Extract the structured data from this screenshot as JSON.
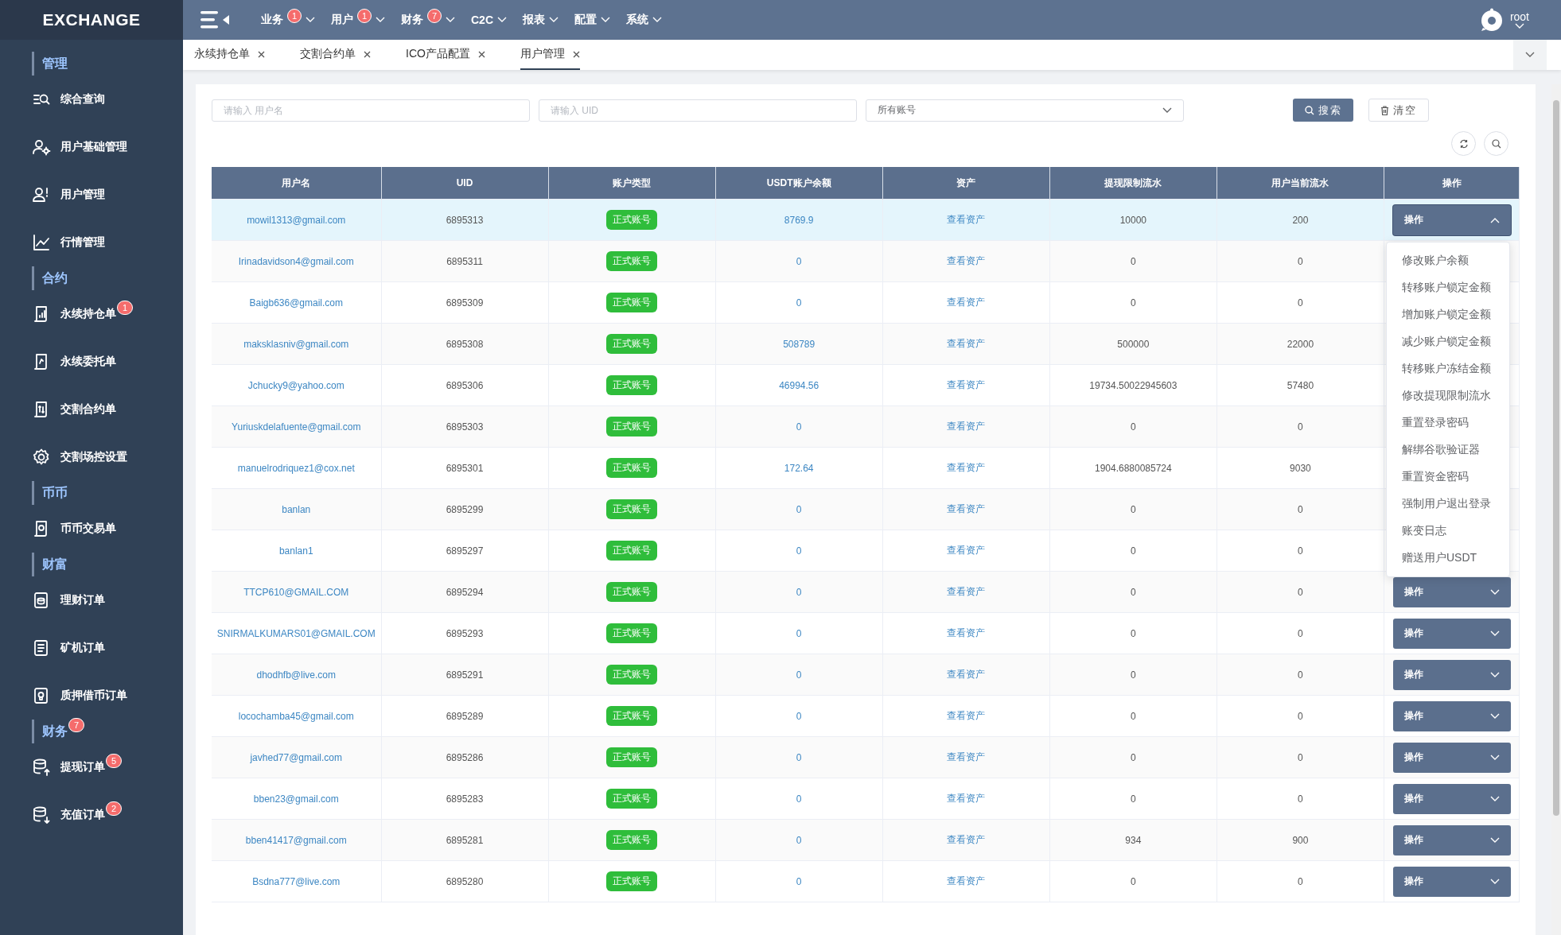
{
  "sidebar": {
    "logo": "EXCHANGE",
    "sections": [
      {
        "title": "管理",
        "items": [
          {
            "label": "综合查询"
          },
          {
            "label": "用户基础管理"
          },
          {
            "label": "用户管理"
          },
          {
            "label": "行情管理"
          }
        ]
      },
      {
        "title": "合约",
        "items": [
          {
            "label": "永续持仓单",
            "badge": "1"
          },
          {
            "label": "永续委托单"
          },
          {
            "label": "交割合约单"
          },
          {
            "label": "交割场控设置"
          }
        ]
      },
      {
        "title": "币币",
        "items": [
          {
            "label": "币币交易单"
          }
        ]
      },
      {
        "title": "财富",
        "items": [
          {
            "label": "理财订单"
          },
          {
            "label": "矿机订单"
          },
          {
            "label": "质押借币订单"
          }
        ]
      },
      {
        "title": "财务",
        "badge": "7",
        "items": [
          {
            "label": "提现订单",
            "badge": "5"
          },
          {
            "label": "充值订单",
            "badge": "2"
          }
        ]
      }
    ]
  },
  "top_nav": {
    "menus": [
      {
        "label": "业务",
        "badge": "1"
      },
      {
        "label": "用户",
        "badge": "1"
      },
      {
        "label": "财务",
        "badge": "7"
      },
      {
        "label": "C2C"
      },
      {
        "label": "报表"
      },
      {
        "label": "配置"
      },
      {
        "label": "系统"
      }
    ],
    "user": "root"
  },
  "tabs": [
    {
      "label": "永续持仓单",
      "selected": false
    },
    {
      "label": "交割合约单",
      "selected": false
    },
    {
      "label": "ICO产品配置",
      "selected": false
    },
    {
      "label": "用户管理",
      "selected": true
    }
  ],
  "filters": {
    "username_placeholder": "请输入 用户名",
    "uid_placeholder": "请输入 UID",
    "account_select": "所有账号",
    "search_button": "搜索",
    "clear_button": "清空"
  },
  "table": {
    "columns": [
      "用户名",
      "UID",
      "账户类型",
      "USDT账户余额",
      "资产",
      "提现限制流水",
      "用户当前流水",
      "操作"
    ],
    "rows": [
      {
        "username": "mowil1313@gmail.com",
        "uid": "6895313",
        "account_type": "正式账号",
        "balance": "8769.9",
        "assets": "查看资产",
        "withdraw_limit": "10000",
        "current_flow": "200",
        "action": "操作",
        "selected": true,
        "expanded": true
      },
      {
        "username": "Irinadavidson4@gmail.com",
        "uid": "6895311",
        "account_type": "正式账号",
        "balance": "0",
        "assets": "查看资产",
        "withdraw_limit": "0",
        "current_flow": "0",
        "selected": false
      },
      {
        "username": "Baigb636@gmail.com",
        "uid": "6895309",
        "account_type": "正式账号",
        "balance": "0",
        "assets": "查看资产",
        "withdraw_limit": "0",
        "current_flow": "0",
        "selected": false
      },
      {
        "username": "maksklasniv@gmail.com",
        "uid": "6895308",
        "account_type": "正式账号",
        "balance": "508789",
        "assets": "查看资产",
        "withdraw_limit": "500000",
        "current_flow": "22000",
        "selected": false
      },
      {
        "username": "Jchucky9@yahoo.com",
        "uid": "6895306",
        "account_type": "正式账号",
        "balance": "46994.56",
        "assets": "查看资产",
        "withdraw_limit": "19734.50022945603",
        "current_flow": "57480",
        "selected": false
      },
      {
        "username": "Yuriuskdelafuente@gmail.com",
        "uid": "6895303",
        "account_type": "正式账号",
        "balance": "0",
        "assets": "查看资产",
        "withdraw_limit": "0",
        "current_flow": "0",
        "selected": false
      },
      {
        "username": "manuelrodriquez1@cox.net",
        "uid": "6895301",
        "account_type": "正式账号",
        "balance": "172.64",
        "assets": "查看资产",
        "withdraw_limit": "1904.6880085724",
        "current_flow": "9030",
        "selected": false
      },
      {
        "username": "banlan",
        "uid": "6895299",
        "account_type": "正式账号",
        "balance": "0",
        "assets": "查看资产",
        "withdraw_limit": "0",
        "current_flow": "0",
        "selected": false
      },
      {
        "username": "banlan1",
        "uid": "6895297",
        "account_type": "正式账号",
        "balance": "0",
        "assets": "查看资产",
        "withdraw_limit": "0",
        "current_flow": "0",
        "selected": false
      },
      {
        "username": "TTCP610@GMAIL.COM",
        "uid": "6895294",
        "account_type": "正式账号",
        "balance": "0",
        "assets": "查看资产",
        "withdraw_limit": "0",
        "current_flow": "0",
        "action": "操作",
        "selected": false,
        "expanded": false
      },
      {
        "username": "SNIRMALKUMARS01@GMAIL.COM",
        "uid": "6895293",
        "account_type": "正式账号",
        "balance": "0",
        "assets": "查看资产",
        "withdraw_limit": "0",
        "current_flow": "0",
        "action": "操作",
        "selected": false,
        "expanded": false
      },
      {
        "username": "dhodhfb@live.com",
        "uid": "6895291",
        "account_type": "正式账号",
        "balance": "0",
        "assets": "查看资产",
        "withdraw_limit": "0",
        "current_flow": "0",
        "action": "操作",
        "selected": false,
        "expanded": false
      },
      {
        "username": "locochamba45@gmail.com",
        "uid": "6895289",
        "account_type": "正式账号",
        "balance": "0",
        "assets": "查看资产",
        "withdraw_limit": "0",
        "current_flow": "0",
        "action": "操作",
        "selected": false,
        "expanded": false
      },
      {
        "username": "javhed77@gmail.com",
        "uid": "6895286",
        "account_type": "正式账号",
        "balance": "0",
        "assets": "查看资产",
        "withdraw_limit": "0",
        "current_flow": "0",
        "action": "操作",
        "selected": false,
        "expanded": false
      },
      {
        "username": "bben23@gmail.com",
        "uid": "6895283",
        "account_type": "正式账号",
        "balance": "0",
        "assets": "查看资产",
        "withdraw_limit": "0",
        "current_flow": "0",
        "action": "操作",
        "selected": false,
        "expanded": false
      },
      {
        "username": "bben41417@gmail.com",
        "uid": "6895281",
        "account_type": "正式账号",
        "balance": "0",
        "assets": "查看资产",
        "withdraw_limit": "934",
        "current_flow": "900",
        "action": "操作",
        "selected": false,
        "expanded": false
      },
      {
        "username": "Bsdna777@live.com",
        "uid": "6895280",
        "account_type": "正式账号",
        "balance": "0",
        "assets": "查看资产",
        "withdraw_limit": "0",
        "current_flow": "0",
        "action": "操作",
        "selected": false,
        "expanded": false
      }
    ]
  },
  "action_menu": {
    "items": [
      "修改账户余额",
      "转移账户锁定金额",
      "增加账户锁定金额",
      "减少账户锁定金额",
      "转移账户冻结金额",
      "修改提现限制流水",
      "重置登录密码",
      "解绑谷歌验证器",
      "重置资金密码",
      "强制用户退出登录",
      "账变日志",
      "赠送用户USDT"
    ]
  }
}
